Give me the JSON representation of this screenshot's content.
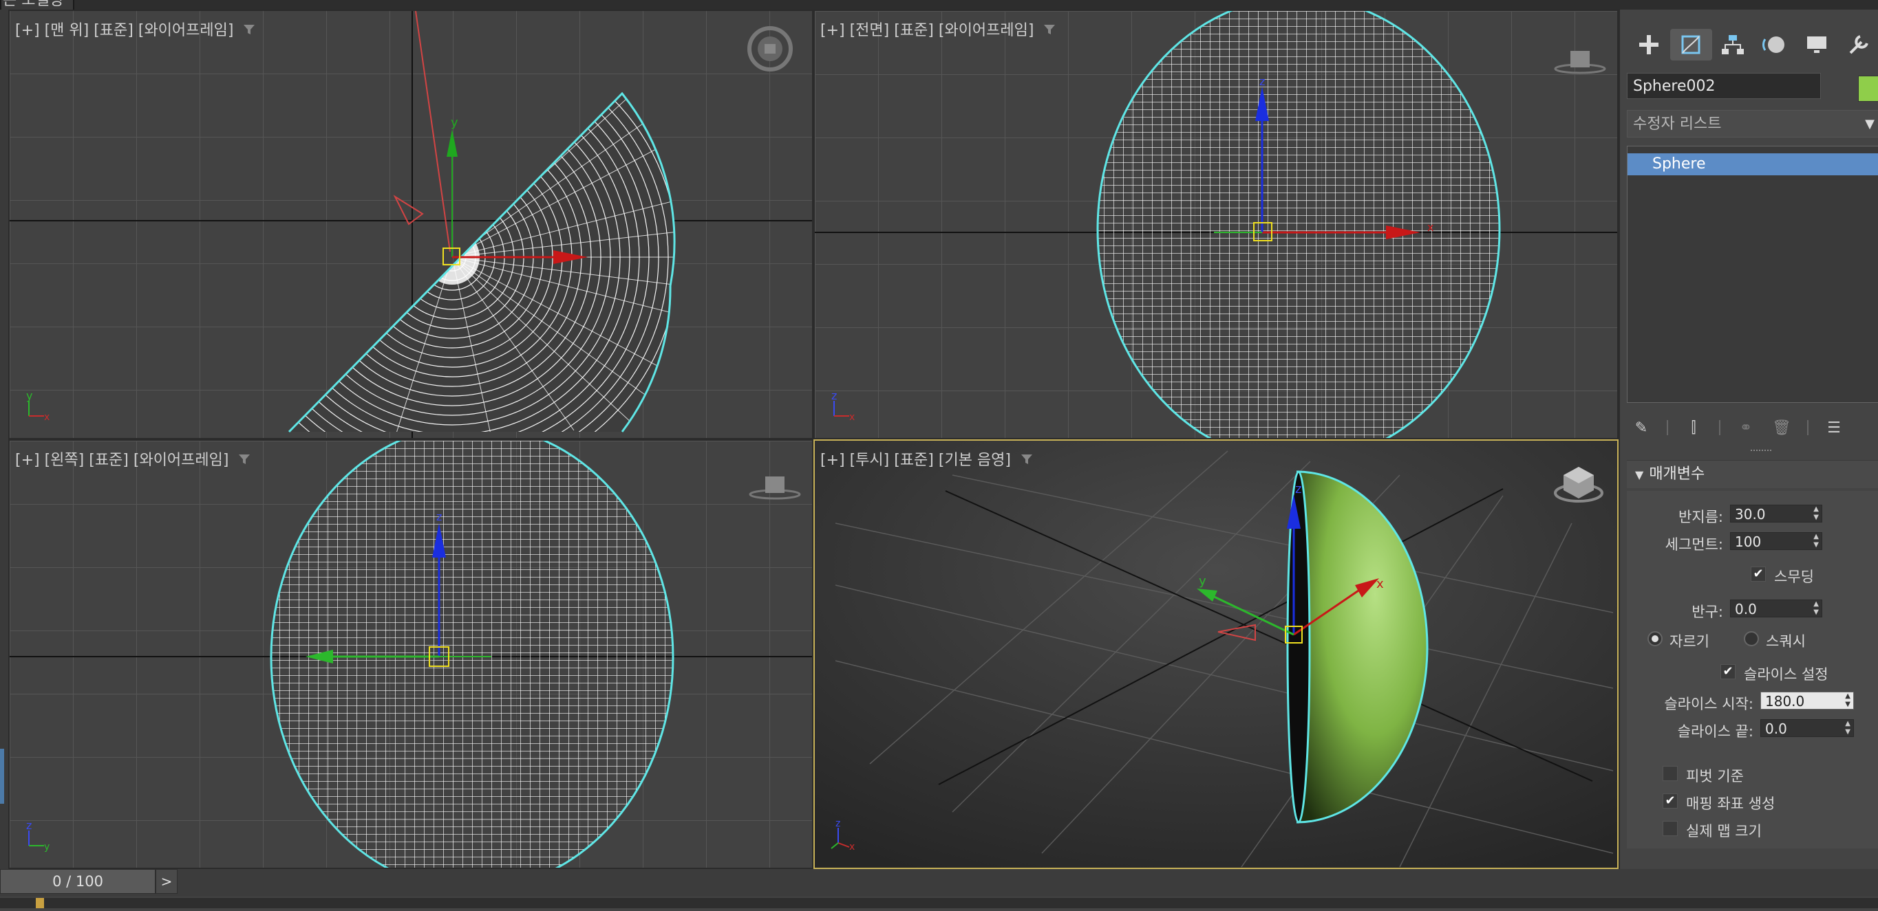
{
  "app": {
    "top_tab": "은 모델링"
  },
  "viewports": {
    "top": {
      "label": "[+] [맨 위] [표준] [와이어프레임]"
    },
    "front": {
      "label": "[+] [전면] [표준] [와이어프레임]"
    },
    "left": {
      "label": "[+] [왼쪽] [표준] [와이어프레임]"
    },
    "persp": {
      "label": "[+] [투시] [표준] [기본 음영]"
    }
  },
  "axes": {
    "x": "x",
    "y": "y",
    "z": "z"
  },
  "panel": {
    "tabs": [
      "create-icon",
      "modify-icon",
      "hierarchy-icon",
      "motion-icon",
      "display-icon",
      "utilities-icon"
    ],
    "object_name": "Sphere002",
    "object_color": "#8fce4a",
    "modifier_list": "수정자 리스트",
    "stack_item": "Sphere",
    "params_title": "매개변수",
    "radius_label": "반지름:",
    "radius_value": "30.0",
    "segments_label": "세그먼트:",
    "segments_value": "100",
    "smooth_label": "스무딩",
    "smooth_checked": true,
    "hemisphere_label": "반구:",
    "hemisphere_value": "0.0",
    "chop_label": "자르기",
    "squash_label": "스쿼시",
    "slice_on_label": "슬라이스 설정",
    "slice_on_checked": true,
    "slice_from_label": "슬라이스 시작:",
    "slice_from_value": "180.0",
    "slice_to_label": "슬라이스 끝:",
    "slice_to_value": "0.0",
    "base_pivot_label": "피벗 기준",
    "base_pivot_checked": false,
    "gen_mapping_label": "매핑 좌표 생성",
    "gen_mapping_checked": true,
    "real_world_label": "실제 맵 크기",
    "real_world_checked": false
  },
  "timeline": {
    "frame": "0 / 100",
    "next": ">"
  },
  "colors": {
    "active_border": "#c8b258",
    "selection_cyan": "#5fe6e6",
    "stack_blue": "#5c8cc6"
  }
}
